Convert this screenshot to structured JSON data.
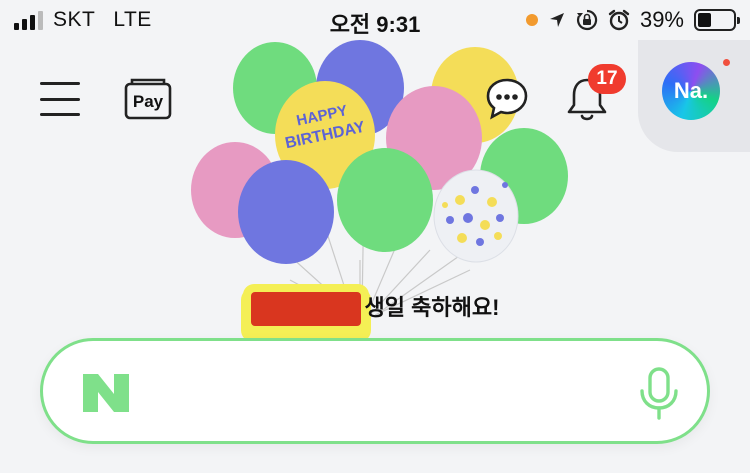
{
  "status_bar": {
    "carrier": "SKT",
    "network": "LTE",
    "time": "오전 9:31",
    "battery": "39%",
    "battery_level": 0.39,
    "icons": [
      "signal-icon",
      "orange-dot-indicator",
      "location-arrow-icon",
      "orientation-lock-icon",
      "alarm-icon",
      "battery-icon"
    ]
  },
  "header": {
    "menu_icon": "hamburger-menu-icon",
    "pay_label": "Pay",
    "chat_icon": "chat-bubble-icon",
    "bell_icon": "bell-icon",
    "notification_count": "17",
    "avatar_label": "Na."
  },
  "banner": {
    "balloon_text_1": "HAPPY",
    "balloon_text_2": "BIRTHDAY",
    "message": "생일 축하해요!"
  },
  "search": {
    "logo": "N",
    "placeholder": "",
    "mic_icon": "microphone-icon"
  },
  "colors": {
    "accent_green": "#7fe08a",
    "badge_red": "#f03b2e",
    "background": "#f3f4f6"
  }
}
